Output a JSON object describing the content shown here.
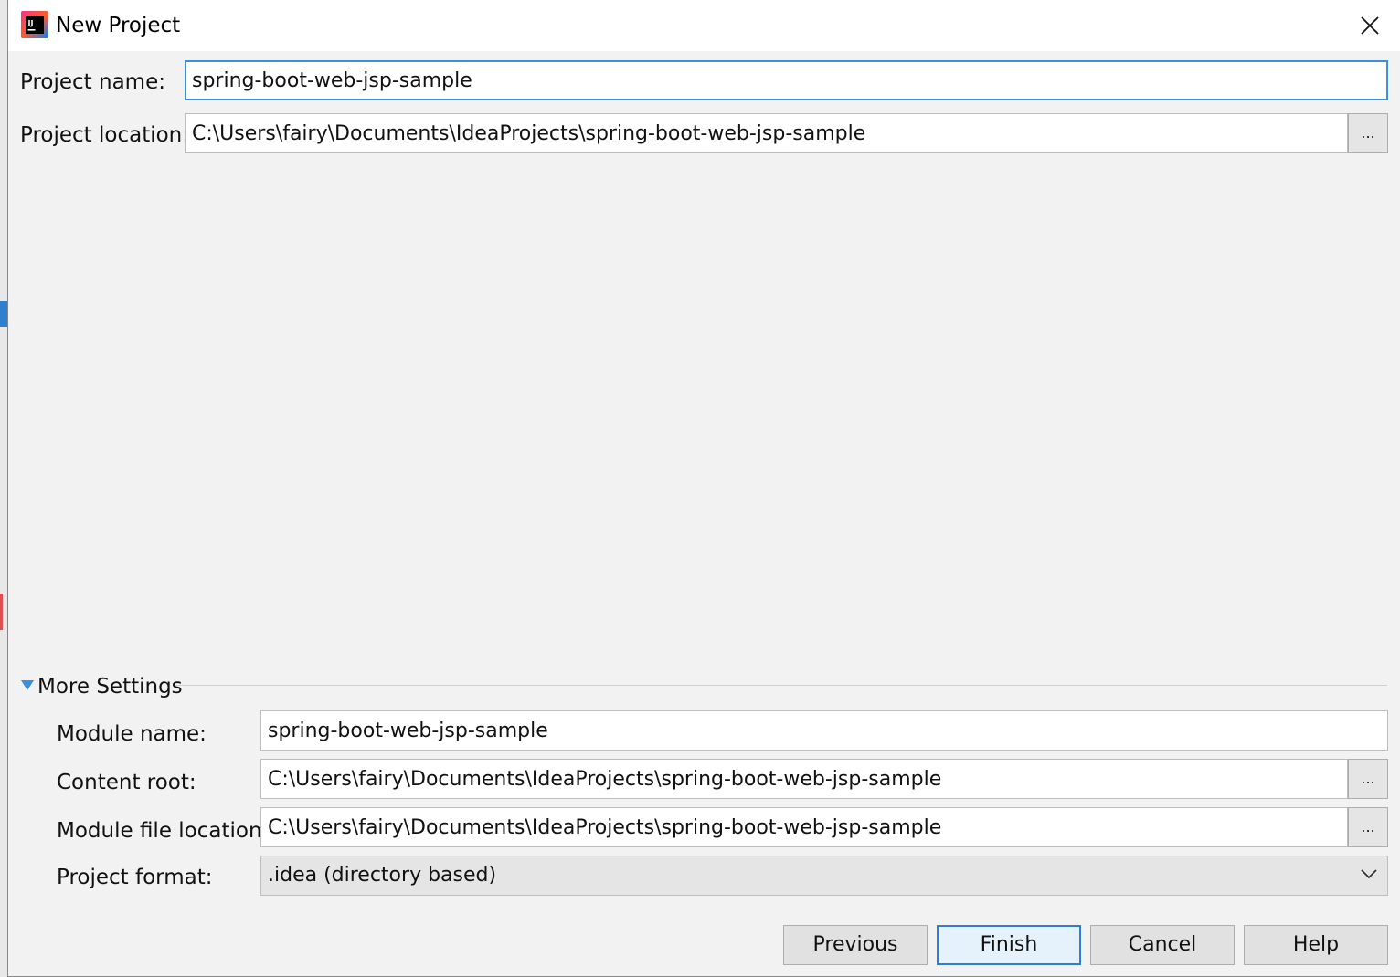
{
  "window": {
    "title": "New Project",
    "app_icon_text": "IJ"
  },
  "project": {
    "name_label": "Project name:",
    "name_value": "spring-boot-web-jsp-sample",
    "location_label": "Project location:",
    "location_value": "C:\\Users\\fairy\\Documents\\IdeaProjects\\spring-boot-web-jsp-sample",
    "browse_label": "..."
  },
  "more_settings": {
    "header": "More Settings",
    "module_name_label": "Module name:",
    "module_name_value": "spring-boot-web-jsp-sample",
    "content_root_label": "Content root:",
    "content_root_value": "C:\\Users\\fairy\\Documents\\IdeaProjects\\spring-boot-web-jsp-sample",
    "module_file_label": "Module file location:",
    "module_file_value": "C:\\Users\\fairy\\Documents\\IdeaProjects\\spring-boot-web-jsp-sample",
    "format_label": "Project format:",
    "format_value": ".idea (directory based)",
    "browse_label": "..."
  },
  "buttons": {
    "previous": "Previous",
    "finish": "Finish",
    "cancel": "Cancel",
    "help": "Help"
  },
  "colors": {
    "focus_blue": "#3c8fd8",
    "dialog_bg": "#f2f2f2"
  },
  "icons": {
    "app": "intellij-idea-icon",
    "close": "close-icon",
    "expand": "triangle-down-icon",
    "dropdown": "chevron-down-icon"
  }
}
